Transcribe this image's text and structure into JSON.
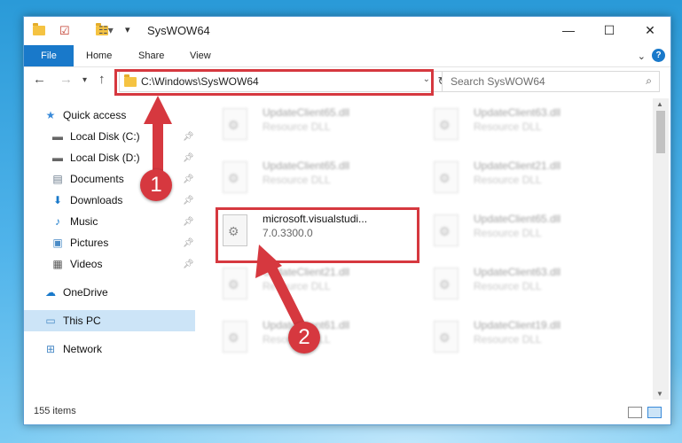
{
  "window": {
    "title": "SysWOW64",
    "controls": {
      "minimize": "—",
      "maximize": "☐",
      "close": "✕"
    }
  },
  "ribbon": {
    "tabs": [
      "File",
      "Home",
      "Share",
      "View"
    ],
    "help": "?"
  },
  "address": {
    "path": "C:\\Windows\\SysWOW64"
  },
  "search": {
    "placeholder": "Search SysWOW64"
  },
  "nav": {
    "quick_access": "Quick access",
    "items": [
      "Local Disk (C:)",
      "Local Disk (D:)",
      "Documents",
      "Downloads",
      "Music",
      "Pictures",
      "Videos"
    ],
    "onedrive": "OneDrive",
    "this_pc": "This PC",
    "network": "Network"
  },
  "files": [
    {
      "name": "UpdateClient65.dll",
      "desc": "Resource DLL"
    },
    {
      "name": "UpdateClient63.dll",
      "desc": "Resource DLL"
    },
    {
      "name": "UpdateClient65.dll",
      "desc": "Resource DLL"
    },
    {
      "name": "UpdateClient21.dll",
      "desc": "Resource DLL"
    },
    {
      "name": "microsoft.visualstudi...",
      "desc": "7.0.3300.0"
    },
    {
      "name": "UpdateClient65.dll",
      "desc": "Resource DLL"
    },
    {
      "name": "UpdateClient21.dll",
      "desc": "Resource DLL"
    },
    {
      "name": "UpdateClient63.dll",
      "desc": "Resource DLL"
    },
    {
      "name": "UpdateClient61.dll",
      "desc": "Resource DLL"
    },
    {
      "name": "UpdateClient19.dll",
      "desc": "Resource DLL"
    }
  ],
  "status": {
    "item_count": "155 items"
  },
  "annotations": {
    "step1": "1",
    "step2": "2"
  },
  "colors": {
    "accent": "#1979ca",
    "highlight": "#d6383f",
    "selection": "#cce4f7"
  }
}
